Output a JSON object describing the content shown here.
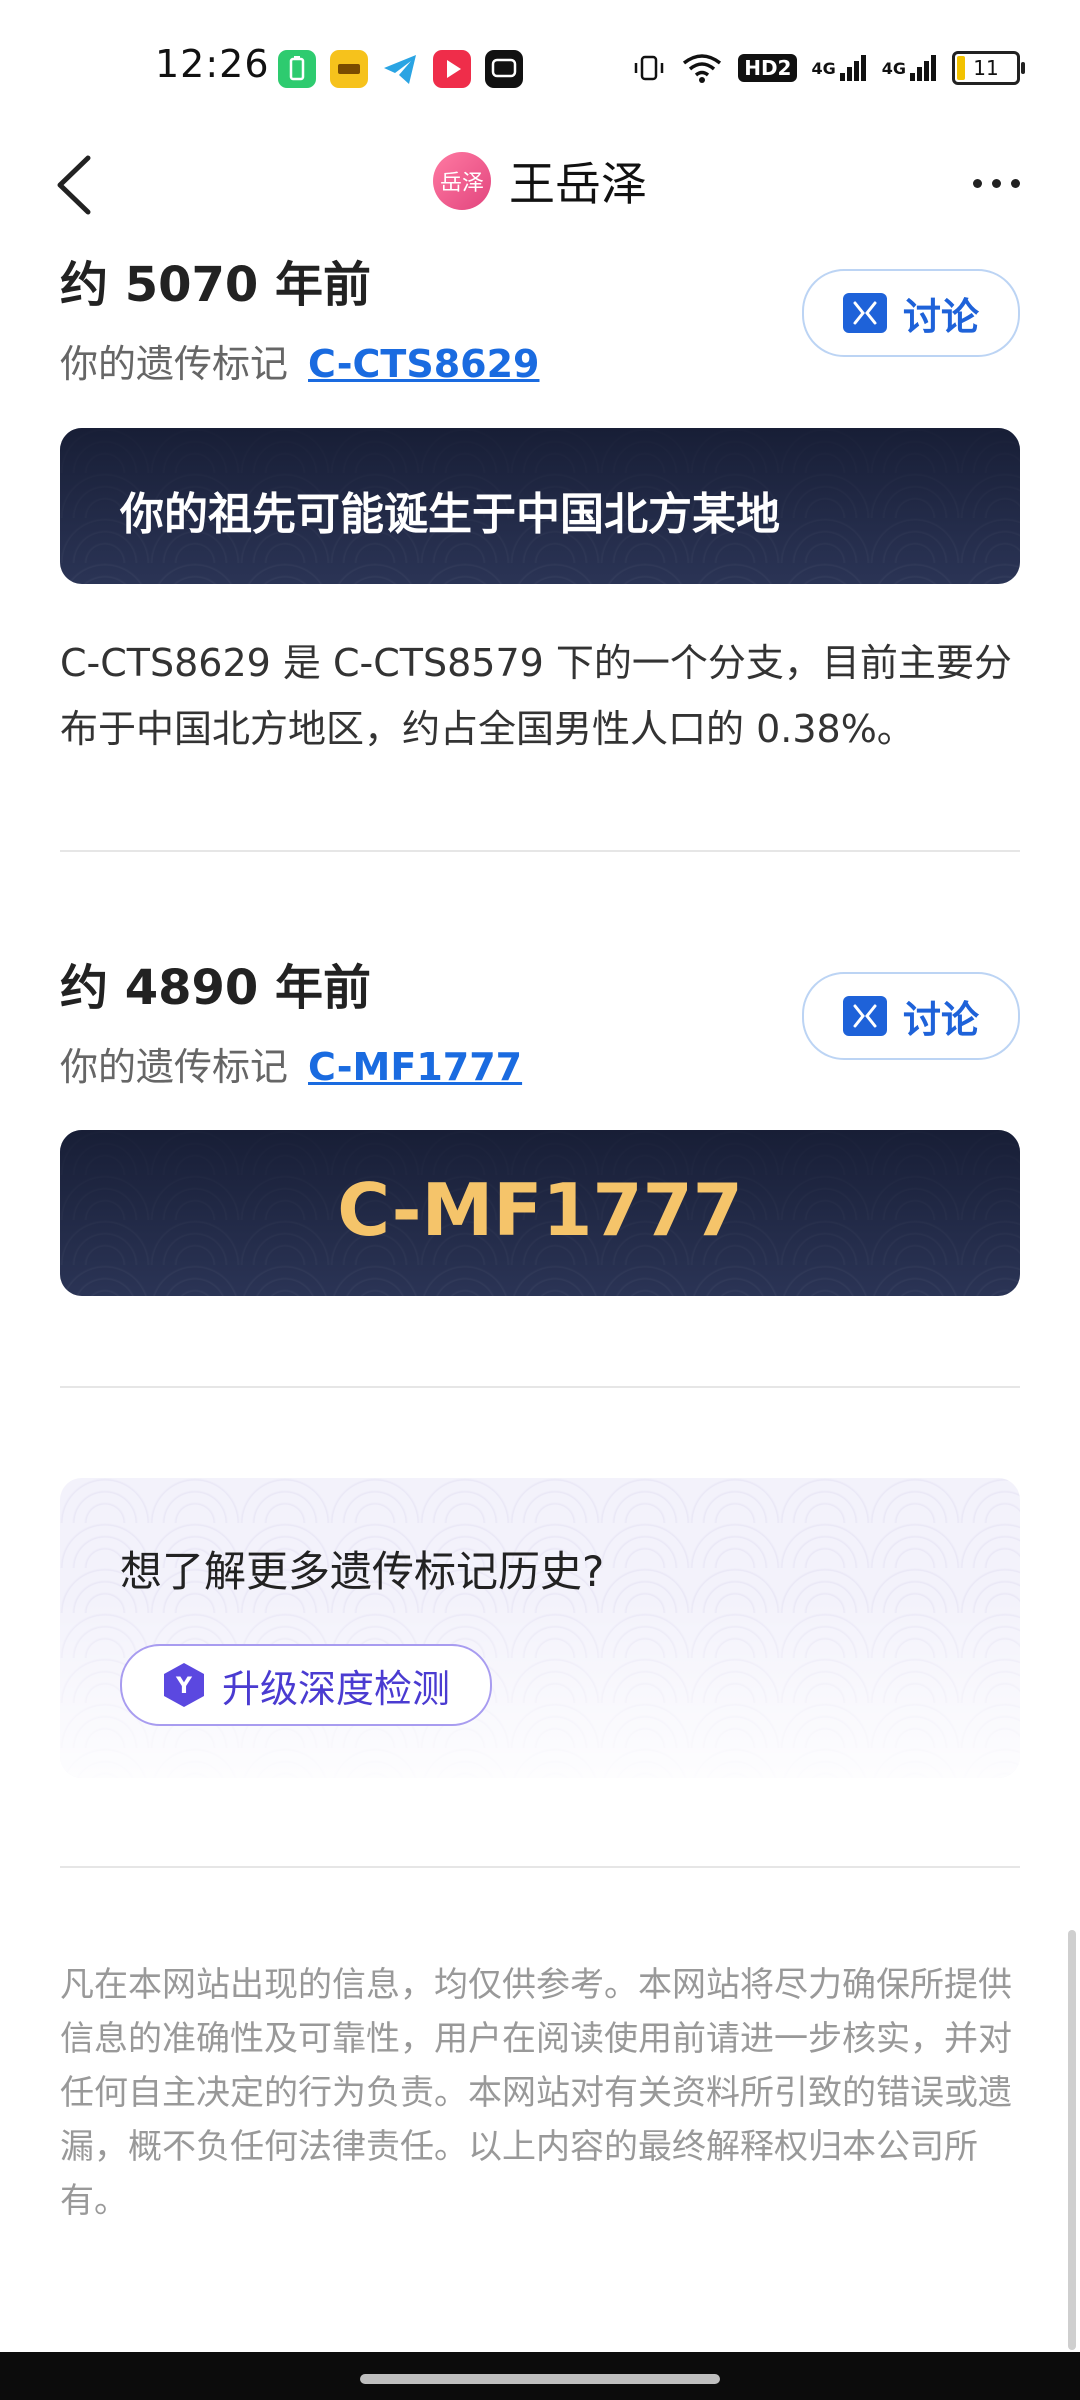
{
  "status_bar": {
    "time": "12:26",
    "network_badge": "HD2",
    "signal1": "4G",
    "signal2": "4G",
    "battery": "11",
    "icons": [
      "battery-saver-app-icon",
      "yellow-app-icon",
      "telegram-icon",
      "video-app-icon",
      "chat-app-icon",
      "vibrate-icon",
      "wifi-icon"
    ]
  },
  "header": {
    "avatar_text": "岳泽",
    "title": "王岳泽"
  },
  "section1": {
    "age": "约 5070 年前",
    "marker_label": "你的遗传标记",
    "marker": "C-CTS8629",
    "discuss_label": "讨论",
    "banner_text": "你的祖先可能诞生于中国北方某地",
    "description": "C-CTS8629 是 C-CTS8579 下的一个分支，目前主要分布于中国北方地区，约占全国男性人口的 0.38%。"
  },
  "section2": {
    "age": "约 4890 年前",
    "marker_label": "你的遗传标记",
    "marker": "C-MF1777",
    "discuss_label": "讨论",
    "banner_text": "C-MF1777"
  },
  "upgrade": {
    "question": "想了解更多遗传标记历史?",
    "button_label": "升级深度检测",
    "icon_letter": "Y"
  },
  "disclaimer": "凡在本网站出现的信息，均仅供参考。本网站将尽力确保所提供信息的准确性及可靠性，用户在阅读使用前请进一步核实，并对任何自主决定的行为负责。本网站对有关资料所引致的错误或遗漏，概不负任何法律责任。以上内容的最终解释权归本公司所有。",
  "colors": {
    "link": "#1a6be0",
    "discuss": "#1e62d9",
    "banner_bg": "#2c3557",
    "marker_gold": "#f5c46a",
    "upgrade_accent": "#4a3bd1"
  }
}
